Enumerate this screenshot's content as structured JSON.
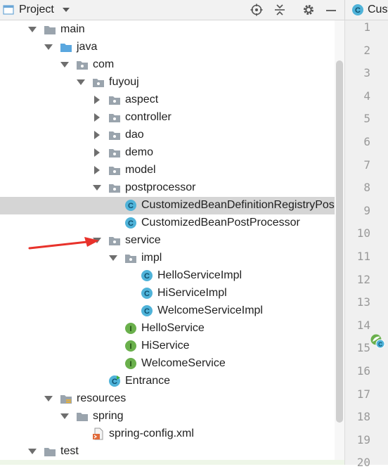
{
  "toolbar": {
    "title": "Project",
    "icons": [
      "target-icon",
      "collapse-icon",
      "gear-icon",
      "minimize-icon"
    ]
  },
  "editor_tab": {
    "label": "Cust"
  },
  "tree": [
    {
      "label": "main",
      "depth": 0,
      "expanded": true,
      "icon": "folder-icon"
    },
    {
      "label": "java",
      "depth": 1,
      "expanded": true,
      "icon": "source-folder-icon"
    },
    {
      "label": "com",
      "depth": 2,
      "expanded": true,
      "icon": "package-icon"
    },
    {
      "label": "fuyouj",
      "depth": 3,
      "expanded": true,
      "icon": "package-icon"
    },
    {
      "label": "aspect",
      "depth": 4,
      "expanded": false,
      "icon": "package-icon"
    },
    {
      "label": "controller",
      "depth": 4,
      "expanded": false,
      "icon": "package-icon"
    },
    {
      "label": "dao",
      "depth": 4,
      "expanded": false,
      "icon": "package-icon"
    },
    {
      "label": "demo",
      "depth": 4,
      "expanded": false,
      "icon": "package-icon"
    },
    {
      "label": "model",
      "depth": 4,
      "expanded": false,
      "icon": "package-icon"
    },
    {
      "label": "postprocessor",
      "depth": 4,
      "expanded": true,
      "icon": "package-icon"
    },
    {
      "label": "CustomizedBeanDefinitionRegistryPostP",
      "depth": 5,
      "icon": "class-icon",
      "selected": true
    },
    {
      "label": "CustomizedBeanPostProcessor",
      "depth": 5,
      "icon": "class-icon"
    },
    {
      "label": "service",
      "depth": 4,
      "expanded": true,
      "icon": "package-icon"
    },
    {
      "label": "impl",
      "depth": 5,
      "expanded": true,
      "icon": "package-icon"
    },
    {
      "label": "HelloServiceImpl",
      "depth": 6,
      "icon": "class-icon"
    },
    {
      "label": "HiServiceImpl",
      "depth": 6,
      "icon": "class-icon"
    },
    {
      "label": "WelcomeServiceImpl",
      "depth": 6,
      "icon": "class-icon"
    },
    {
      "label": "HelloService",
      "depth": 5,
      "icon": "interface-icon"
    },
    {
      "label": "HiService",
      "depth": 5,
      "icon": "interface-icon"
    },
    {
      "label": "WelcomeService",
      "depth": 5,
      "icon": "interface-icon"
    },
    {
      "label": "Entrance",
      "depth": 4,
      "icon": "runnable-class-icon"
    },
    {
      "label": "resources",
      "depth": 1,
      "expanded": true,
      "icon": "resources-folder-icon"
    },
    {
      "label": "spring",
      "depth": 2,
      "expanded": true,
      "icon": "folder-icon"
    },
    {
      "label": "spring-config.xml",
      "depth": 3,
      "icon": "xml-file-icon"
    },
    {
      "label": "test",
      "depth": 0,
      "expanded": true,
      "icon": "folder-icon"
    }
  ],
  "line_numbers": [
    "1",
    "2",
    "3",
    "4",
    "5",
    "6",
    "7",
    "8",
    "9",
    "10",
    "11",
    "12",
    "13",
    "14",
    "15",
    "16",
    "17",
    "18",
    "19",
    "20"
  ],
  "colors": {
    "class_icon": "#4fb3d9",
    "interface_icon": "#6ab04c",
    "selected_row": "#d5d5d5",
    "annotation_arrow": "#e8322b"
  }
}
